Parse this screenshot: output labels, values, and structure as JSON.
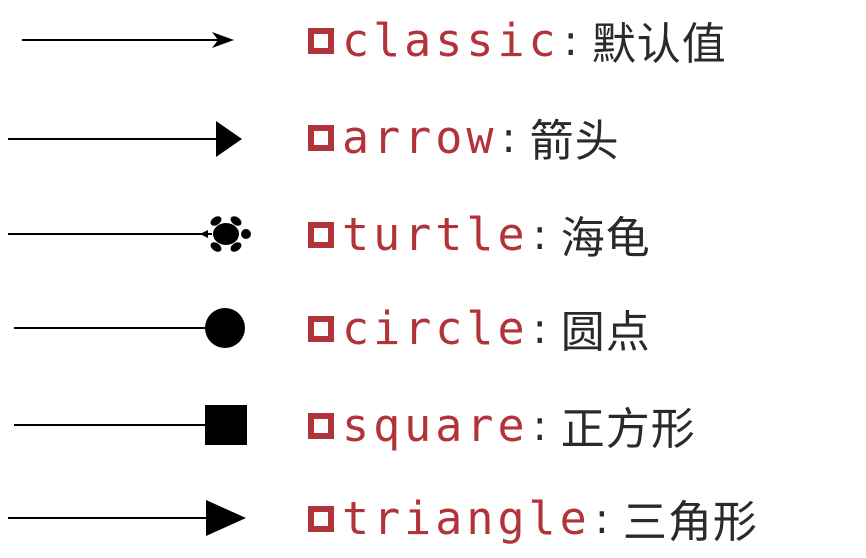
{
  "items": [
    {
      "code": "classic",
      "colon": ":",
      "desc": "默认值",
      "marker": "classic-arrowhead-icon"
    },
    {
      "code": "arrow",
      "colon": ":",
      "desc": "箭头",
      "marker": "filled-arrowhead-icon"
    },
    {
      "code": "turtle",
      "colon": ":",
      "desc": "海龟",
      "marker": "turtle-icon"
    },
    {
      "code": "circle",
      "colon": ":",
      "desc": "圆点",
      "marker": "circle-icon"
    },
    {
      "code": "square",
      "colon": ":",
      "desc": "正方形",
      "marker": "square-icon"
    },
    {
      "code": "triangle",
      "colon": ":",
      "desc": "三角形",
      "marker": "triangle-icon"
    }
  ],
  "colors": {
    "code": "#b3333b",
    "text": "#2a2a2a",
    "line": "#000000"
  }
}
